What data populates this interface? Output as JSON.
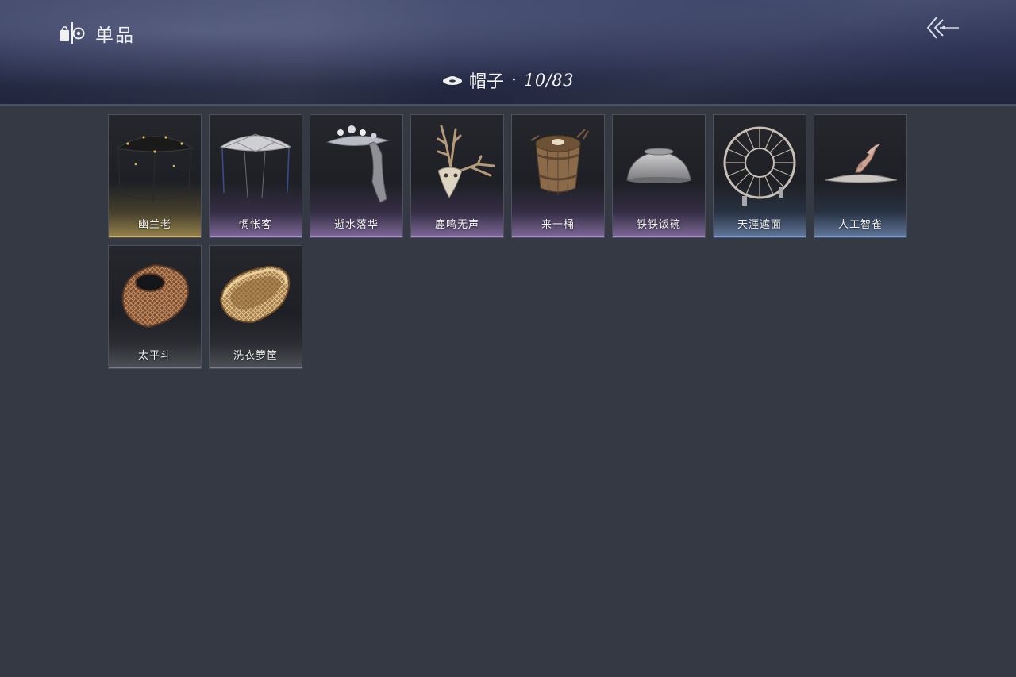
{
  "header": {
    "section_title": "单品",
    "section_icon": "outfit-icon",
    "back_icon": "back-arrow-icon"
  },
  "category": {
    "icon": "hat-icon",
    "name": "帽子",
    "separator": "·",
    "count": "10/83"
  },
  "items": [
    {
      "name": "幽兰老",
      "rarity": "gold",
      "icon": "black-veil-hat-icon"
    },
    {
      "name": "惆怅客",
      "rarity": "purple",
      "icon": "white-veil-hat-icon"
    },
    {
      "name": "逝水落华",
      "rarity": "purple",
      "icon": "flower-scarf-hat-icon"
    },
    {
      "name": "鹿鸣无声",
      "rarity": "purple",
      "icon": "deer-skull-hat-icon"
    },
    {
      "name": "来一桶",
      "rarity": "purple",
      "icon": "wooden-bucket-hat-icon"
    },
    {
      "name": "铁铁饭碗",
      "rarity": "purple",
      "icon": "iron-bowl-hat-icon"
    },
    {
      "name": "天涯遮面",
      "rarity": "blue",
      "icon": "round-frame-hat-icon"
    },
    {
      "name": "人工智雀",
      "rarity": "blue",
      "icon": "bird-hat-icon"
    },
    {
      "name": "太平斗",
      "rarity": "gray",
      "icon": "bamboo-cage-hat-icon"
    },
    {
      "name": "洗衣箩筐",
      "rarity": "gray",
      "icon": "laundry-basket-hat-icon"
    }
  ]
}
